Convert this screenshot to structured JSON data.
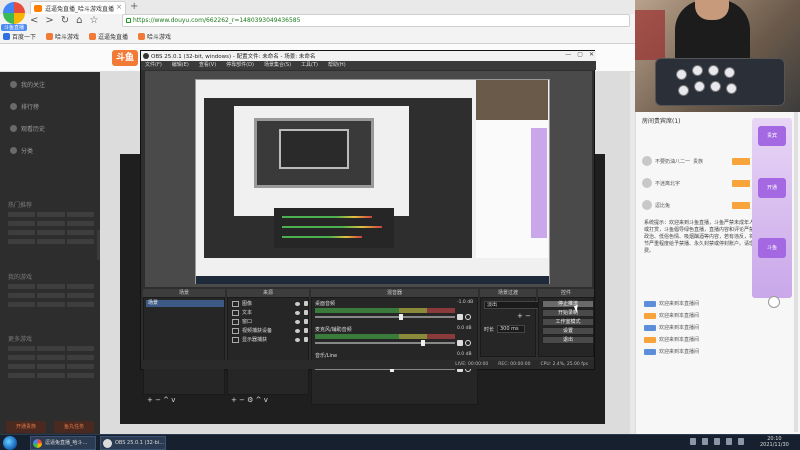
{
  "browser": {
    "logo_label": "斗鱼直播",
    "tab_title": "逗逼兔直播_哈斗游戏直播",
    "url": "https://www.douyu.com/662262_r=1480393049436585",
    "bookmarks": [
      "百度一下",
      "哈斗游戏",
      "逗逼兔直播",
      "哈斗游戏"
    ],
    "nav_glyphs": [
      "<",
      ">",
      "↻",
      "⌂",
      "☆"
    ]
  },
  "douyu": {
    "logo": "斗鱼",
    "sidebar": {
      "items": [
        "我的关注",
        "排行榜",
        "观看历史",
        "分类"
      ],
      "section1": "热门推荐",
      "section2": "我的游戏",
      "section3": "更多游戏",
      "btn1": "开通贵族",
      "btn2": "鱼丸任务"
    }
  },
  "obs": {
    "title": "OBS 25.0.1 (32-bit, windows) - 配置文件: 未命名 - 场景: 未命名",
    "menu": [
      "文件(F)",
      "编辑(E)",
      "查看(V)",
      "停靠部件(D)",
      "场景集合(S)",
      "工具(T)",
      "帮助(H)"
    ],
    "win_btns": [
      "—",
      "▢",
      "✕"
    ],
    "panels": {
      "scenes": "场景",
      "sources": "来源",
      "mixer": "混音器",
      "transitions": "场景过渡",
      "controls": "控件"
    },
    "scene_items": [
      "场景"
    ],
    "sources": [
      "图像",
      "文本",
      "窗口",
      "视频捕获设备",
      "显示器捕获"
    ],
    "mixer": [
      {
        "label": "桌面音频",
        "db": "-1.0 dB",
        "level": 0.62
      },
      {
        "label": "麦克风/辅助音频",
        "db": "0.0 dB",
        "level": 0.78
      },
      {
        "label": "音乐/Line",
        "db": "0.0 dB",
        "level": 0.55
      }
    ],
    "transition": {
      "value": "淡出",
      "duration_label": "时长",
      "duration": "300 ms"
    },
    "controls": [
      "停止推流",
      "开始录制",
      "工作室模式",
      "设置",
      "退出"
    ],
    "tools": "+ − ^ v",
    "status": {
      "live": "LIVE: 00:00:00",
      "rec": "REC: 00:00:00",
      "cpu": "CPU: 2.4%, 25.00 fps"
    }
  },
  "chat": {
    "tabs": "房间贵宾席(1)",
    "users": [
      {
        "name": "不要奶油八二一",
        "tag": "贵族"
      },
      {
        "name": "不迷离北宇",
        "tag": ""
      },
      {
        "name": "逗比兔",
        "tag": ""
      }
    ],
    "notice": "系统提示：欢迎来到斗鱼直播，斗鱼严禁未成年人直播或打赏，斗鱼倡导绿色直播，直播内容和评论严禁包含政治、低俗色情、吸烟酗酒等内容，若有违反，将视情节严重程度给予禁播、永久封禁或停封账户。请理性消费。",
    "lines": [
      "欢迎来到本直播间",
      "欢迎来到本直播间",
      "欢迎来到本直播间",
      "欢迎来到本直播间",
      "欢迎来到本直播间"
    ],
    "promo": [
      "贵宾",
      "开通",
      "斗鱼"
    ]
  },
  "taskbar": {
    "buttons": [
      "逗逼兔直播_哈斗...",
      "OBS 25.0.1 (32-bi..."
    ],
    "time": "20:10",
    "date": "2021/11/30"
  }
}
